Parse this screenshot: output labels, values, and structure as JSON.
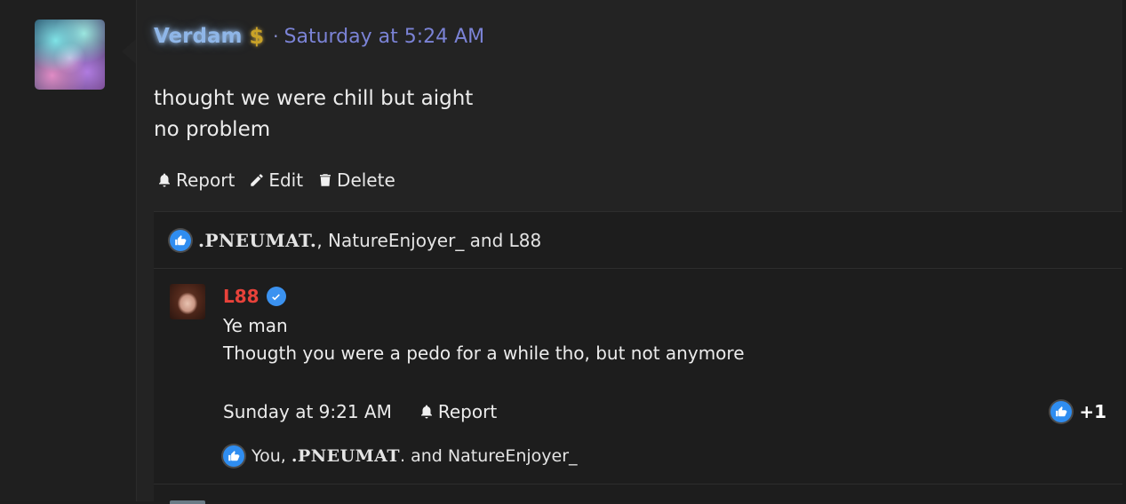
{
  "post": {
    "author": "Verdam",
    "author_badge_icon": "dollar-sign-icon",
    "separator": "·",
    "timestamp": "Saturday at 5:24 AM",
    "lines": [
      "thought we were chill but aight",
      "no problem"
    ],
    "actions": {
      "report": "Report",
      "edit": "Edit",
      "delete": "Delete"
    },
    "likes": {
      "icon": "thumbs-up-icon",
      "first": ".PNEUMAT.",
      "rest": ", NatureEnjoyer_ and L88"
    }
  },
  "reply": {
    "author": "L88",
    "author_color": "#e8423a",
    "verified_icon": "verified-check-icon",
    "lines": [
      "Ye man",
      "Thougth you were a pedo for a while tho, but not anymore"
    ],
    "timestamp": "Sunday at 9:21 AM",
    "report": "Report",
    "reaction_count": "+1",
    "likes": {
      "prefix": "You, ",
      "bold": ".PNEUMAT",
      "suffix": ". and NatureEnjoyer_"
    }
  },
  "colors": {
    "background": "#1e1e1e",
    "username_glow": "#8fb6e8",
    "timestamp": "#7b83d6",
    "like_blue": "#2f8df0"
  }
}
